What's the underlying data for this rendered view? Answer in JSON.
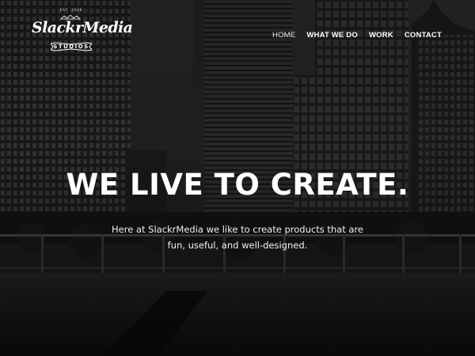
{
  "brand": {
    "est_text": "EST. 2008",
    "name": "SlackrMedia",
    "subtitle": "STUDIOS"
  },
  "nav": {
    "items": [
      {
        "label": "HOME",
        "active": true
      },
      {
        "label": "WHAT WE DO",
        "active": false
      },
      {
        "label": "WORK",
        "active": false
      },
      {
        "label": "CONTACT",
        "active": false
      }
    ]
  },
  "hero": {
    "headline": "WE LIVE TO CREATE.",
    "tagline": "Here at SlackrMedia we like to create products that are fun, useful, and well-designed."
  },
  "colors": {
    "text": "#ffffff",
    "background": "#0b0b0b"
  }
}
